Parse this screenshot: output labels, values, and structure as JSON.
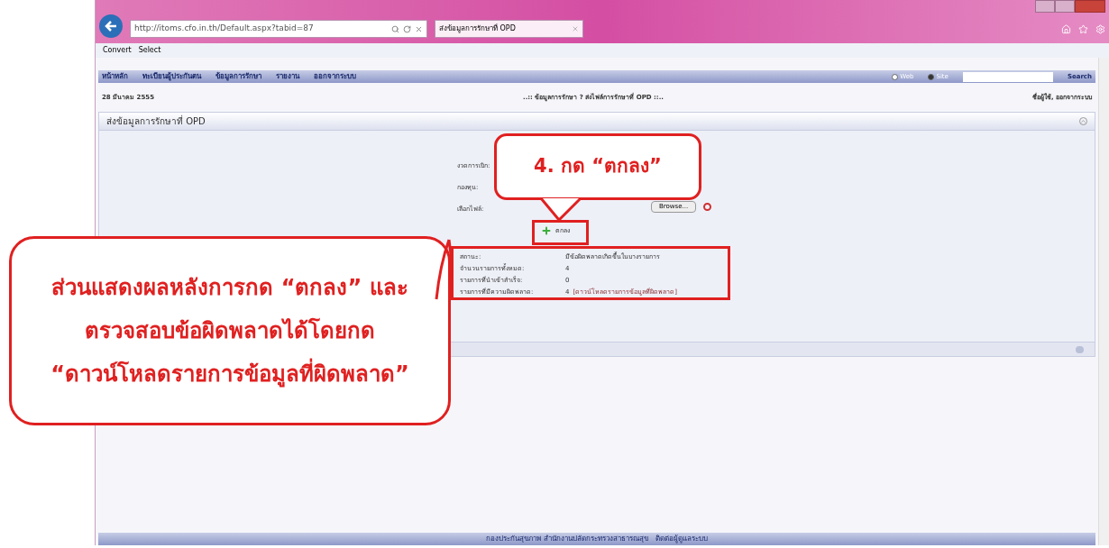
{
  "browser": {
    "address": "http://itoms.cfo.in.th/Default.aspx?tabid=87",
    "tab_title": "ส่งข้อมูลการรักษาที่ OPD",
    "command_bar": [
      "Convert",
      "Select"
    ]
  },
  "menu": [
    "หน้าหลัก",
    "ทะเบียนผู้ประกันตน",
    "ข้อมูลการรักษา",
    "รายงาน",
    "ออกจากระบบ"
  ],
  "search": {
    "options": [
      {
        "label": "Web",
        "selected": false
      },
      {
        "label": "Site",
        "selected": true
      }
    ],
    "button": "Search"
  },
  "date": "28 มีนาคม 2555",
  "breadcrumb": "..:: ข้อมูลการรักษา ? ส่งไฟล์การรักษาที่ OPD ::..",
  "user_links": "ชื่อผู้ใช้, ออกจากระบบ",
  "panel": {
    "title": "ส่งข้อมูลการรักษาที่ OPD",
    "form": [
      {
        "kind": "plain",
        "label": "งวดการเบิก:"
      },
      {
        "kind": "plain",
        "label": "กองทุน:"
      },
      {
        "kind": "file",
        "label": "เลือกไฟล์:",
        "button": "Browse..."
      }
    ],
    "submit": "ตกลง",
    "results": [
      {
        "label": "สถานะ:",
        "value": "มีข้อผิดพลาดเกิดขึ้นในบางรายการ"
      },
      {
        "label": "จำนวนรายการทั้งหมด:",
        "value": "4"
      },
      {
        "label": "รายการที่นำเข้าสำเร็จ:",
        "value": "0"
      },
      {
        "label": "รายการที่มีความผิดพลาด:",
        "value": "4",
        "link": "[ดาวน์โหลดรายการข้อมูลที่ผิดพลาด]"
      }
    ]
  },
  "footer": "กองประกันสุขภาพ สำนักงานปลัดกระทรวงสาธารณสุข   ติดต่อผู้ดูแลระบบ",
  "callouts": [
    {
      "lines": [
        "4. กด “ตกลง”"
      ]
    },
    {
      "lines": [
        "ส่วนแสดงผลหลังการกด “ตกลง” และ",
        "ตรวจสอบข้อผิดพลาดได้โดยกด",
        "“ดาวน์โหลดรายการข้อมูลที่ผิดพลาด”"
      ]
    }
  ]
}
